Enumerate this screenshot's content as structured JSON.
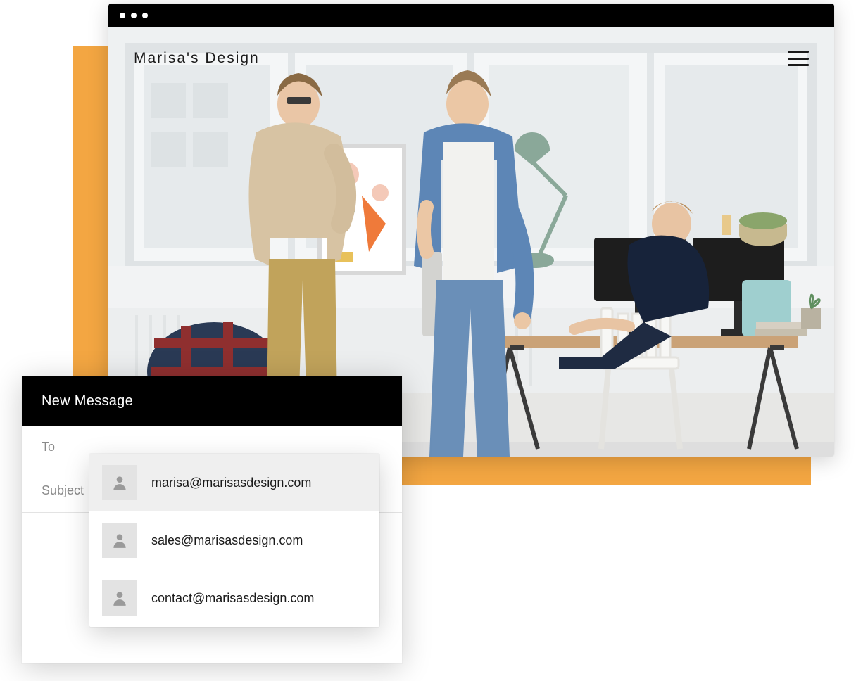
{
  "site": {
    "title": "Marisa's Design",
    "menu_icon": "hamburger-icon"
  },
  "compose": {
    "header": "New Message",
    "to_label": "To",
    "subject_label": "Subject"
  },
  "autocomplete": {
    "suggestions": [
      {
        "email": "marisa@marisasdesign.com",
        "highlight": true
      },
      {
        "email": "sales@marisasdesign.com",
        "highlight": false
      },
      {
        "email": "contact@marisasdesign.com",
        "highlight": false
      }
    ]
  },
  "colors": {
    "accent": "#f3a642",
    "titlebar": "#000000"
  }
}
